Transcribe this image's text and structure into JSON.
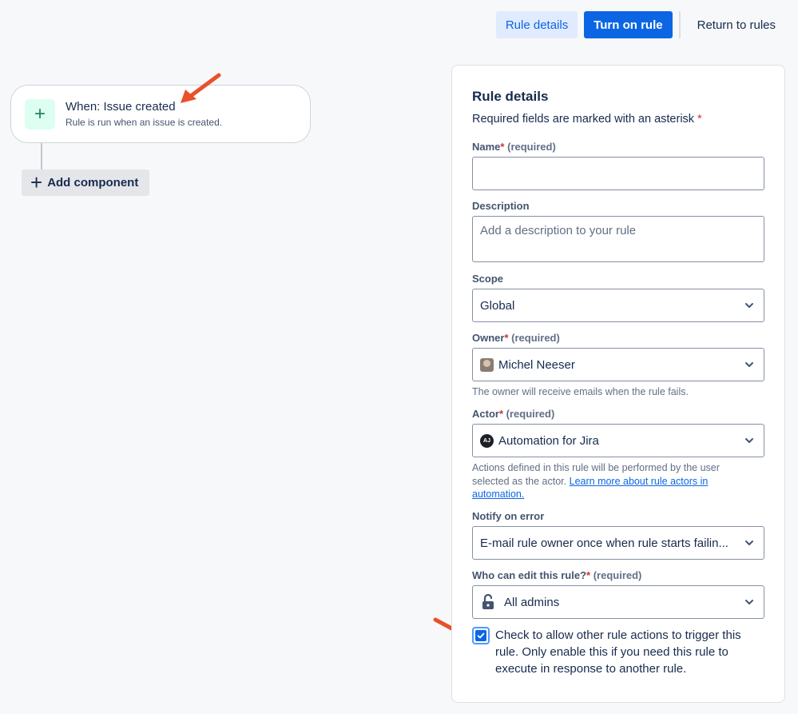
{
  "header": {
    "rule_details_button": "Rule details",
    "turn_on_button": "Turn on rule",
    "return_button": "Return to rules"
  },
  "canvas": {
    "trigger_title": "When: Issue created",
    "trigger_subtitle": "Rule is run when an issue is created.",
    "trigger_icon": "+",
    "add_component_label": "Add component",
    "add_component_icon": "+"
  },
  "panel": {
    "title": "Rule details",
    "required_note": "Required fields are marked with an asterisk",
    "asterisk": "*",
    "name": {
      "label": "Name",
      "required": "(required)",
      "value": ""
    },
    "description": {
      "label": "Description",
      "placeholder": "Add a description to your rule"
    },
    "scope": {
      "label": "Scope",
      "value": "Global"
    },
    "owner": {
      "label": "Owner",
      "required": "(required)",
      "value": "Michel Neeser",
      "help": "The owner will receive emails when the rule fails."
    },
    "actor": {
      "label": "Actor",
      "required": "(required)",
      "value": "Automation for Jira",
      "avatar_text": "AJ",
      "help": "Actions defined in this rule will be performed by the user selected as the actor.",
      "help_link": "Learn more about rule actors in automation."
    },
    "notify": {
      "label": "Notify on error",
      "value": "E-mail rule owner once when rule starts failin..."
    },
    "editors": {
      "label": "Who can edit this rule?",
      "required": "(required)",
      "value": "All admins"
    },
    "allow_trigger": {
      "checked": true,
      "text": "Check to allow other rule actions to trigger this rule. Only enable this if you need this rule to execute in response to another rule."
    }
  },
  "colors": {
    "primary": "#0c66e4",
    "annotation_arrow": "#e8512a",
    "required_asterisk": "#c9372c"
  },
  "icons": [
    "plus-icon",
    "chevron-down-icon",
    "lock-open-icon",
    "check-icon",
    "avatar-icon",
    "arrow-annotation-icon"
  ]
}
